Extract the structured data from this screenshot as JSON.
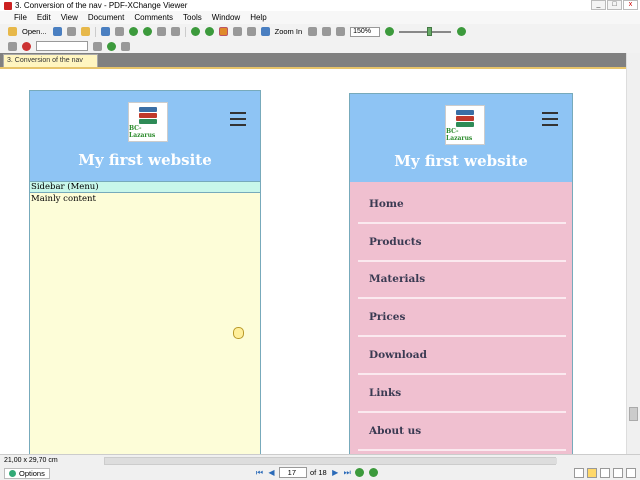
{
  "window": {
    "title": "3. Conversion of the nav - PDF-XChange Viewer",
    "buttons": {
      "minimize": "_",
      "maximize": "□",
      "close": "x"
    }
  },
  "menubar": {
    "items": [
      "File",
      "Edit",
      "View",
      "Document",
      "Comments",
      "Tools",
      "Window",
      "Help"
    ]
  },
  "toolbar": {
    "open_label": "Open...",
    "zoom_in_label": "Zoom In",
    "zoom_value": "150%"
  },
  "tab": {
    "label": "3. Conversion of the nav",
    "close": "x"
  },
  "left_mock": {
    "logo_text": "BC-Lazarus",
    "site_title": "My first website",
    "sidebar_text": "Sidebar (Menu)",
    "main_text": "Mainly content"
  },
  "right_mock": {
    "logo_text": "BC-Lazarus",
    "site_title": "My first website",
    "nav_items": [
      "Home",
      "Products",
      "Materials",
      "Prices",
      "Download",
      "Links",
      "About us"
    ]
  },
  "status": {
    "page_size": "21,00 x 29,70 cm",
    "options_label": "Options",
    "current_page": "17",
    "page_of": "of 18"
  },
  "colors": {
    "header_blue": "#8ec4f4",
    "left_body": "#fdfdd8",
    "sidebar_bar": "#c8f7ea",
    "right_body": "#f0c0d0",
    "nav_text": "#3a3a52"
  }
}
